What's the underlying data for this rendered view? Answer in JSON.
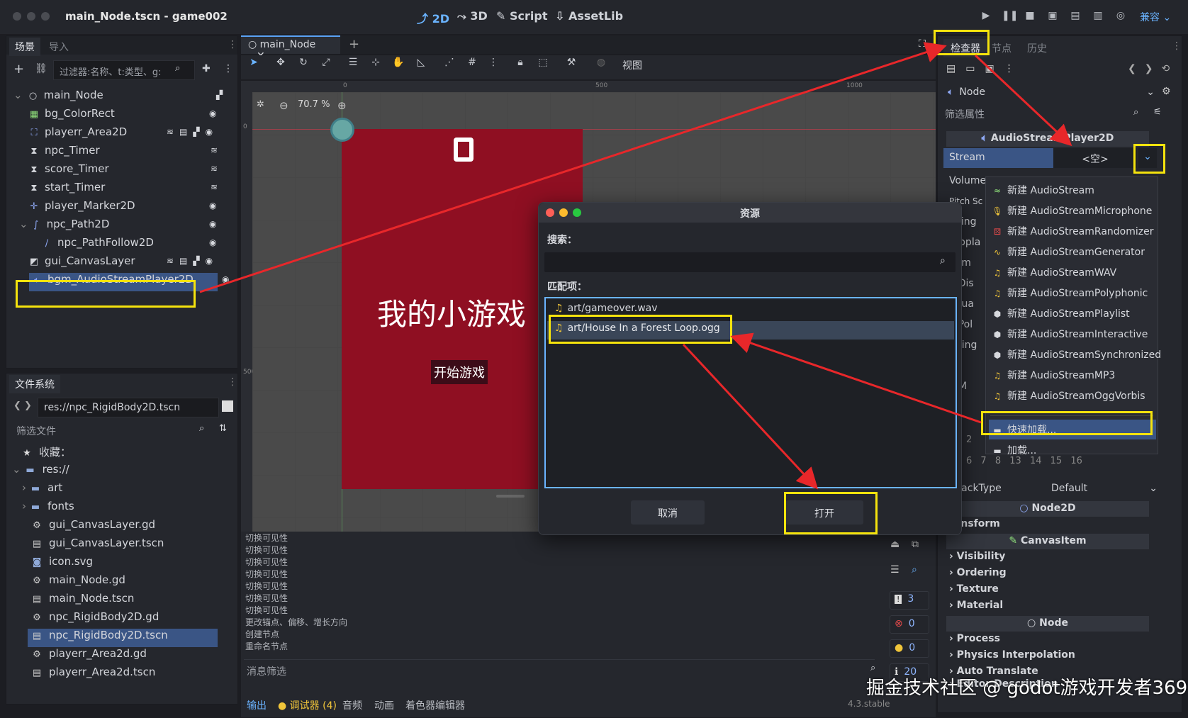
{
  "window": {
    "title": "main_Node.tscn - game002"
  },
  "workspaces": [
    {
      "label": "2D",
      "icon": "2d-icon"
    },
    {
      "label": "3D",
      "icon": "3d-icon"
    },
    {
      "label": "Script",
      "icon": "script-icon"
    },
    {
      "label": "AssetLib",
      "icon": "assetlib-icon"
    }
  ],
  "renderer": "兼容",
  "scene_dock": {
    "tabs": [
      "场景",
      "导入"
    ],
    "filter_placeholder": "过滤器:名称、t:类型、g:",
    "nodes": [
      {
        "label": "main_Node",
        "icon": "node-icon"
      },
      {
        "label": "bg_ColorRect",
        "icon": "color-rect-icon"
      },
      {
        "label": "playerr_Area2D",
        "icon": "area2d-icon"
      },
      {
        "label": "npc_Timer",
        "icon": "timer-icon"
      },
      {
        "label": "score_Timer",
        "icon": "timer-icon"
      },
      {
        "label": "start_Timer",
        "icon": "timer-icon"
      },
      {
        "label": "player_Marker2D",
        "icon": "marker-icon"
      },
      {
        "label": "npc_Path2D",
        "icon": "path-icon"
      },
      {
        "label": "npc_PathFollow2D",
        "icon": "path-follow-icon"
      },
      {
        "label": "gui_CanvasLayer",
        "icon": "canvas-layer-icon"
      },
      {
        "label": "bgm_AudioStreamPlayer2D",
        "icon": "audio-icon"
      }
    ]
  },
  "filesystem": {
    "title": "文件系统",
    "path": "res://npc_RigidBody2D.tscn",
    "filter_placeholder": "筛选文件",
    "items": [
      "收藏：",
      "res://",
      "art",
      "fonts",
      "gui_CanvasLayer.gd",
      "gui_CanvasLayer.tscn",
      "icon.svg",
      "main_Node.gd",
      "main_Node.tscn",
      "npc_RigidBody2D.gd",
      "npc_RigidBody2D.tscn",
      "playerr_Area2d.gd",
      "playerr_Area2d.tscn"
    ]
  },
  "editor": {
    "tab": "main_Node",
    "zoom": "70.7 %",
    "view_menu": "视图",
    "ruler": [
      "0",
      "500",
      "1000"
    ],
    "ruler_v": [
      "0",
      "500"
    ],
    "game_title": "我的小游戏",
    "game_title_visible": "我的小游戏",
    "start_button": "开始游戏"
  },
  "output": {
    "lines": [
      "切换可见性",
      "切换可见性",
      "切换可见性",
      "切换可见性",
      "切换可见性",
      "切换可见性",
      "切换可见性",
      "更改锚点、偏移、增长方向",
      "创建节点",
      "重命名节点"
    ],
    "filter_placeholder": "消息筛选",
    "counts": [
      "3",
      "0",
      "0",
      "20"
    ]
  },
  "bottom_tabs": [
    "输出",
    "调试器 (4)",
    "音频",
    "动画",
    "着色器编辑器"
  ],
  "version": "4.3.stable",
  "dialog": {
    "title": "资源",
    "search_label": "搜索：",
    "matches_label": "匹配项：",
    "matches": [
      "art/gameover.wav",
      "art/House In a Forest Loop.ogg"
    ],
    "cancel": "取消",
    "open": "打开"
  },
  "inspector": {
    "tabs": [
      "检查器",
      "节点",
      "历史"
    ],
    "node": "Node",
    "filter_placeholder": "筛选属性",
    "class_header": "AudioStreamPlayer2D",
    "stream_label": "Stream",
    "stream_value": "<空>",
    "props": [
      "Volume",
      "Pitch Sc",
      "aying",
      "utopla",
      "eam",
      "x Dis",
      "enua",
      "x Pol",
      "nning",
      "s",
      "a M"
    ],
    "playback_type_label": "ybackType",
    "playback_type_value": "Default",
    "node2d": "Node2D",
    "transform": "ransform",
    "canvasitem": "CanvasItem",
    "categories": [
      "Visibility",
      "Ordering",
      "Texture",
      "Material"
    ],
    "node_categories": [
      "Process",
      "Physics Interpolation",
      "Auto Translate",
      "Editor Description"
    ],
    "bits": [
      "2",
      "6",
      "7",
      "8",
      "13",
      "14",
      "15",
      "16"
    ]
  },
  "stream_menu": {
    "items": [
      "新建 AudioStream",
      "新建 AudioStreamMicrophone",
      "新建 AudioStreamRandomizer",
      "新建 AudioStreamGenerator",
      "新建 AudioStreamWAV",
      "新建 AudioStreamPolyphonic",
      "新建 AudioStreamPlaylist",
      "新建 AudioStreamInteractive",
      "新建 AudioStreamSynchronized",
      "新建 AudioStreamMP3",
      "新建 AudioStreamOggVorbis"
    ],
    "quick_load": "快速加载...",
    "load": "加载..."
  },
  "watermark": "掘金技术社区 @ godot游戏开发者369",
  "colors": {
    "accent": "#6ab3ff",
    "highlight": "#f5e30d",
    "arrow": "#e8272a",
    "game_bg": "#8f0f22"
  }
}
